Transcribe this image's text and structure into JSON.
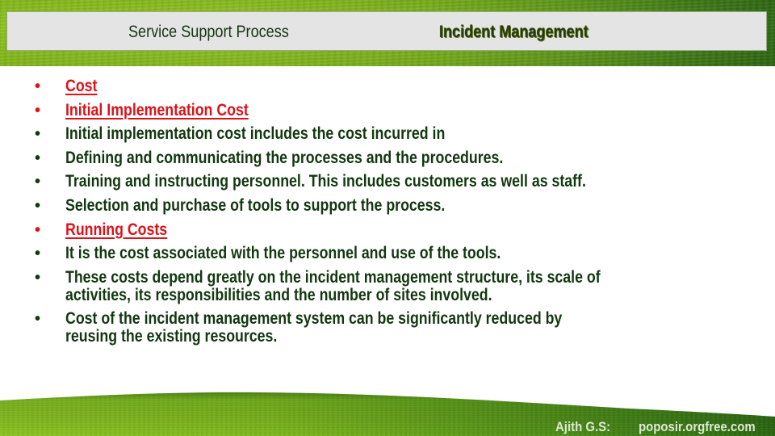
{
  "header": {
    "section_title": "Service Support Process",
    "topic_title": "Incident Management"
  },
  "colors": {
    "heading_red": "#d9141a",
    "body_green": "#12380f",
    "header_bar": "#e4e4e4",
    "grass_light": "#8cc21c",
    "grass_dark": "#2f6b12"
  },
  "items": [
    {
      "text": "Cost",
      "style": "red"
    },
    {
      "text": "Initial Implementation Cost",
      "style": "red"
    },
    {
      "text": "Initial implementation cost includes the cost incurred in",
      "style": "dark"
    },
    {
      "text": "Defining and communicating the processes and the procedures.",
      "style": "dark"
    },
    {
      "text": "Training and instructing personnel. This includes customers as well as staff.",
      "style": "dark"
    },
    {
      "text": "Selection and purchase of tools to support the process.",
      "style": "dark"
    },
    {
      "text": "Running Costs",
      "style": "red"
    },
    {
      "text": "It is the cost associated with the personnel and use of the tools.",
      "style": "dark"
    },
    {
      "text": "These costs depend greatly on the incident management structure, its scale of\nactivities, its responsibilities and the number of sites involved.",
      "style": "dark"
    },
    {
      "text": "Cost of the incident management system can be significantly reduced by\nreusing the existing resources.",
      "style": "dark"
    }
  ],
  "bullet_glyph": "•",
  "footer": {
    "author": "Ajith G.S:",
    "website": "poposir.orgfree.com"
  }
}
